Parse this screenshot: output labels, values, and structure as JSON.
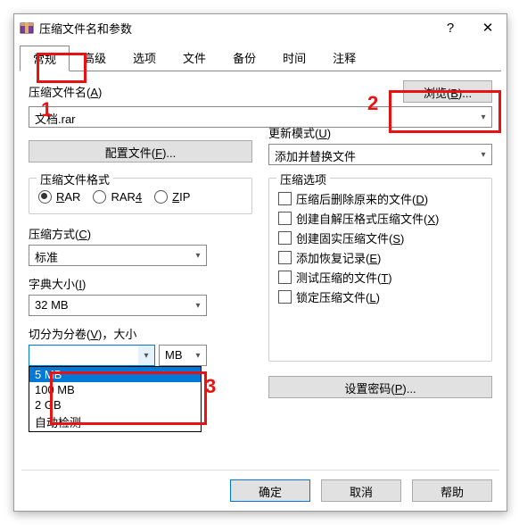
{
  "title": "压缩文件名和参数",
  "help_glyph": "?",
  "close_glyph": "✕",
  "tabs": [
    "常规",
    "高级",
    "选项",
    "文件",
    "备份",
    "时间",
    "注释"
  ],
  "filename_label_pre": "压缩文件名(",
  "filename_label_key": "A",
  "filename_label_post": ")",
  "browse_pre": "浏览(",
  "browse_key": "B",
  "browse_post": ")...",
  "filename_value": "文档.rar",
  "update_label_pre": "更新模式(",
  "update_label_key": "U",
  "update_label_post": ")",
  "update_value": "添加并替换文件",
  "profiles_pre": "配置文件(",
  "profiles_key": "F",
  "profiles_post": ")...",
  "format_group": "压缩文件格式",
  "fmt_rar_pre": "R",
  "fmt_rar_post": "AR",
  "fmt_rar4_pre": "RAR",
  "fmt_rar4_key": "4",
  "fmt_zip_pre": "",
  "fmt_zip_key": "Z",
  "fmt_zip_post": "IP",
  "method_label_pre": "压缩方式(",
  "method_label_key": "C",
  "method_label_post": ")",
  "method_value": "标准",
  "dict_label_pre": "字典大小(",
  "dict_label_key": "I",
  "dict_label_post": ")",
  "dict_value": "32 MB",
  "split_label_pre": "切分为分卷(",
  "split_label_key": "V",
  "split_label_post": ")，大小",
  "split_value": "",
  "split_unit": "MB",
  "options_group": "压缩选项",
  "opt_delete_pre": "压缩后删除原来的文件(",
  "opt_delete_key": "D",
  "opt_delete_post": ")",
  "opt_sfx_pre": "创建自解压格式压缩文件(",
  "opt_sfx_key": "X",
  "opt_sfx_post": ")",
  "opt_solid_pre": "创建固实压缩文件(",
  "opt_solid_key": "S",
  "opt_solid_post": ")",
  "opt_recovery_pre": "添加恢复记录(",
  "opt_recovery_key": "E",
  "opt_recovery_post": ")",
  "opt_test_pre": "测试压缩的文件(",
  "opt_test_key": "T",
  "opt_test_post": ")",
  "opt_lock_pre": "锁定压缩文件(",
  "opt_lock_key": "L",
  "opt_lock_post": ")",
  "password_pre": "设置密码(",
  "password_key": "P",
  "password_post": ")...",
  "ok": "确定",
  "cancel": "取消",
  "help": "帮助",
  "drop_sel": "5 MB",
  "drop_1": "100 MB",
  "drop_2": "2 GB",
  "drop_3": "自动检测",
  "ann1": "1",
  "ann2": "2",
  "ann3": "3"
}
